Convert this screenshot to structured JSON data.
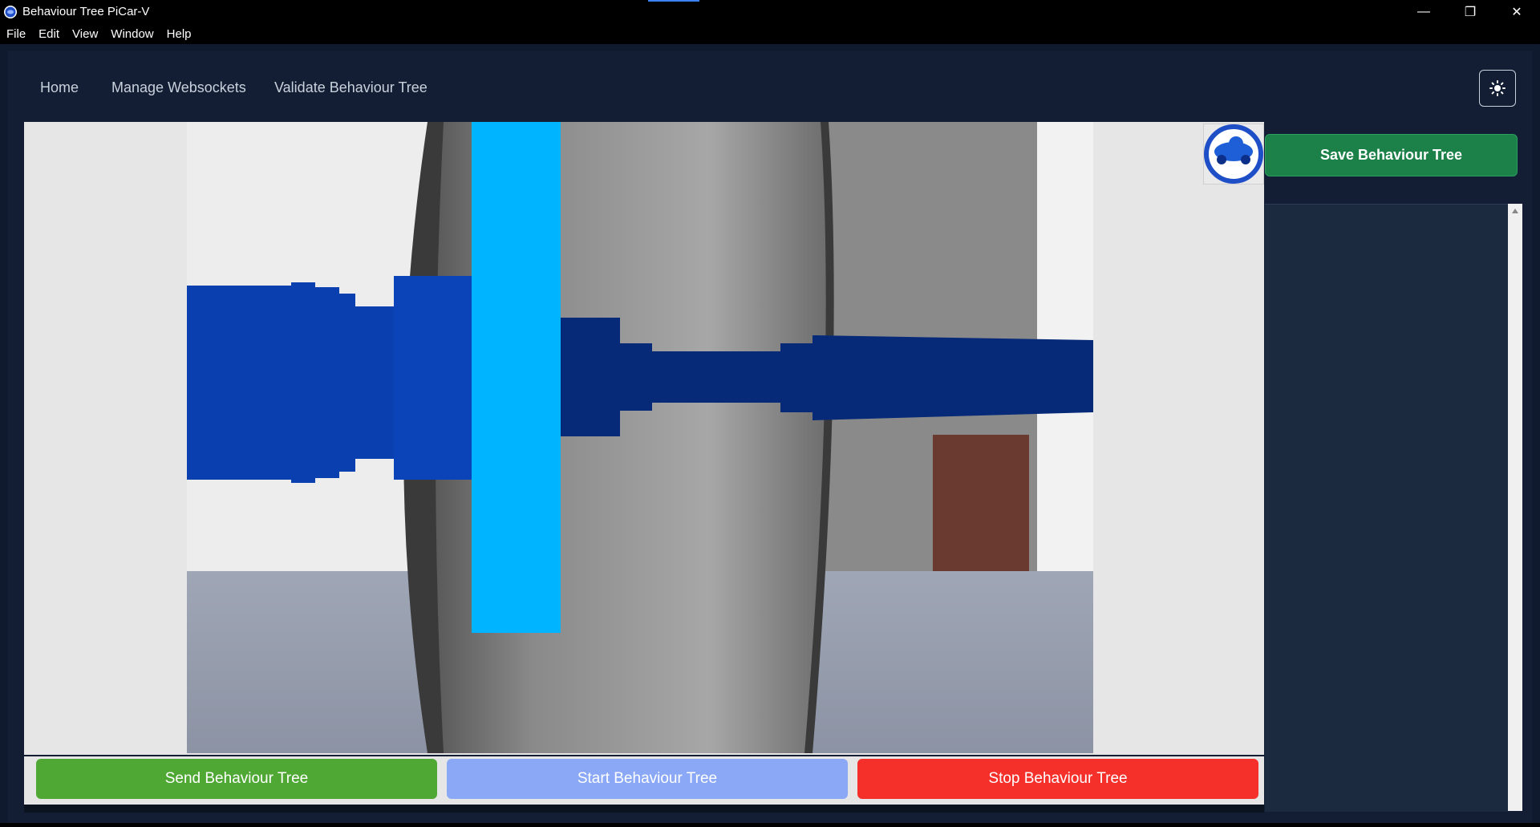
{
  "window": {
    "title": "Behaviour Tree PiCar-V",
    "minimize_glyph": "—",
    "restore_glyph": "❐",
    "close_glyph": "✕"
  },
  "menu": [
    "File",
    "Edit",
    "View",
    "Window",
    "Help"
  ],
  "nav": {
    "links": [
      "Home",
      "Manage Websockets",
      "Validate Behaviour Tree"
    ],
    "theme_icon": "sun-icon"
  },
  "camera": {
    "description_icon": "camera-feed"
  },
  "logo_icon": "picar-logo-icon",
  "buttons": {
    "send": "Send Behaviour Tree",
    "start": "Start Behaviour Tree",
    "stop": "Stop Behaviour Tree",
    "save": "Save Behaviour Tree"
  },
  "colors": {
    "send": "#4fa834",
    "start": "#8aa8f5",
    "stop": "#f5302b",
    "save": "#1c8049",
    "bar_highlight": "#00b4ff",
    "bar_blue": "#0a3fb0",
    "bar_dark": "#062a78"
  }
}
